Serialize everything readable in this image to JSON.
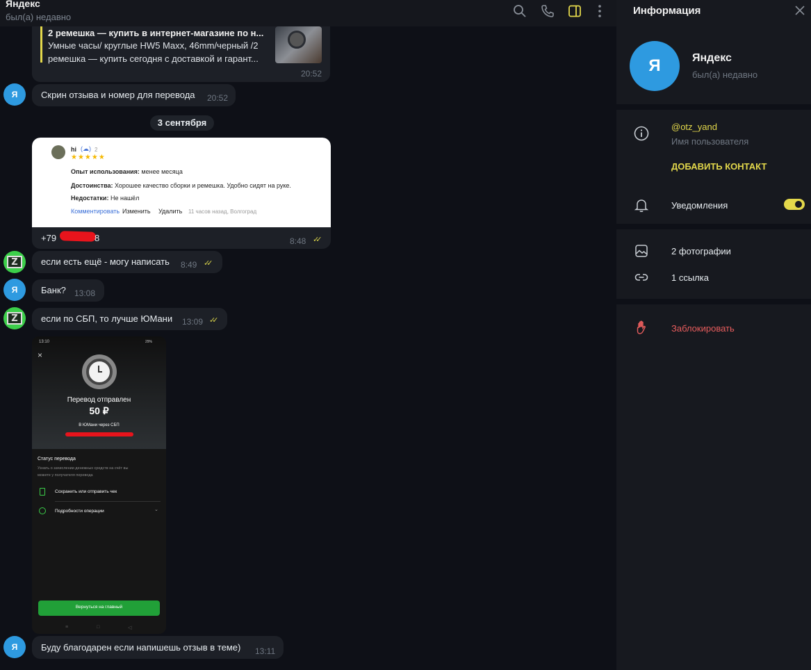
{
  "header": {
    "title": "Яндекс",
    "status": "был(а) недавно"
  },
  "messages": {
    "link_preview": {
      "title": "2 ремешка — купить в интернет-магазине по н...",
      "desc_line1": "Умные часы/ круглые HW5 Maxx, 46mm/черный /2",
      "desc_line2": "ремешка — купить сегодня с доставкой и гарант...",
      "time": "20:52"
    },
    "m1": {
      "text": "Скрин отзыва и номер для перевода",
      "time": "20:52",
      "avatar": "Я"
    },
    "date_divider": "3 сентября",
    "review": {
      "author": "hi",
      "count": "2",
      "stars": "★★★★★",
      "exp_label": "Опыт использования:",
      "exp_value": " менее месяца",
      "pros_label": "Достоинства:",
      "pros_value": " Хорошее качество сборки и ремешка. Удобно сидят на руке.",
      "cons_label": "Недостатки:",
      "cons_value": " Не нашёл",
      "comment": "Комментировать",
      "edit": "Изменить",
      "delete": "Удалить",
      "meta": "11 часов назад, Волгоград",
      "phone": "+79",
      "phone_end": "8",
      "time": "8:48"
    },
    "m2": {
      "text": "если есть ещё - могу написать",
      "time": "8:49"
    },
    "m3": {
      "text": "Банк?",
      "time": "13:08",
      "avatar": "Я"
    },
    "m4": {
      "text": "если по СБП, то лучше ЮМани",
      "time": "13:09"
    },
    "receipt": {
      "status_time": "13:10",
      "battery": "29%",
      "close": "×",
      "title": "Перевод отправлен",
      "amount": "50 ₽",
      "sub": "В ЮМани через СБП",
      "status_heading": "Статус перевода",
      "status_text1": "Узнать о зачислении денежных средств на счёт вы",
      "status_text2": "можете у получателя перевода",
      "save": "Сохранить или отправить чек",
      "details": "Подробности операции",
      "back": "Вернуться на главный"
    },
    "m5": {
      "text": "Буду благодарен если напишешь отзыв в теме)",
      "time": "13:11",
      "avatar": "Я"
    }
  },
  "info": {
    "title": "Информация",
    "avatar_letter": "Я",
    "name": "Яндекс",
    "status": "был(а) недавно",
    "username": "@otz_yand",
    "username_label": "Имя пользователя",
    "add_contact": "ДОБАВИТЬ КОНТАКТ",
    "notifications": "Уведомления",
    "photos": "2 фотографии",
    "links": "1 ссылка",
    "block": "Заблокировать"
  },
  "colors": {
    "accent": "#e3d84b",
    "avatar_blue": "#2e9ae0",
    "danger": "#e85d5d",
    "green_button": "#21a038"
  },
  "icons": [
    "search-icon",
    "phone-icon",
    "sidebar-toggle-icon",
    "more-icon",
    "close-icon",
    "info-icon",
    "bell-icon",
    "photo-icon",
    "link-icon",
    "hand-icon"
  ]
}
